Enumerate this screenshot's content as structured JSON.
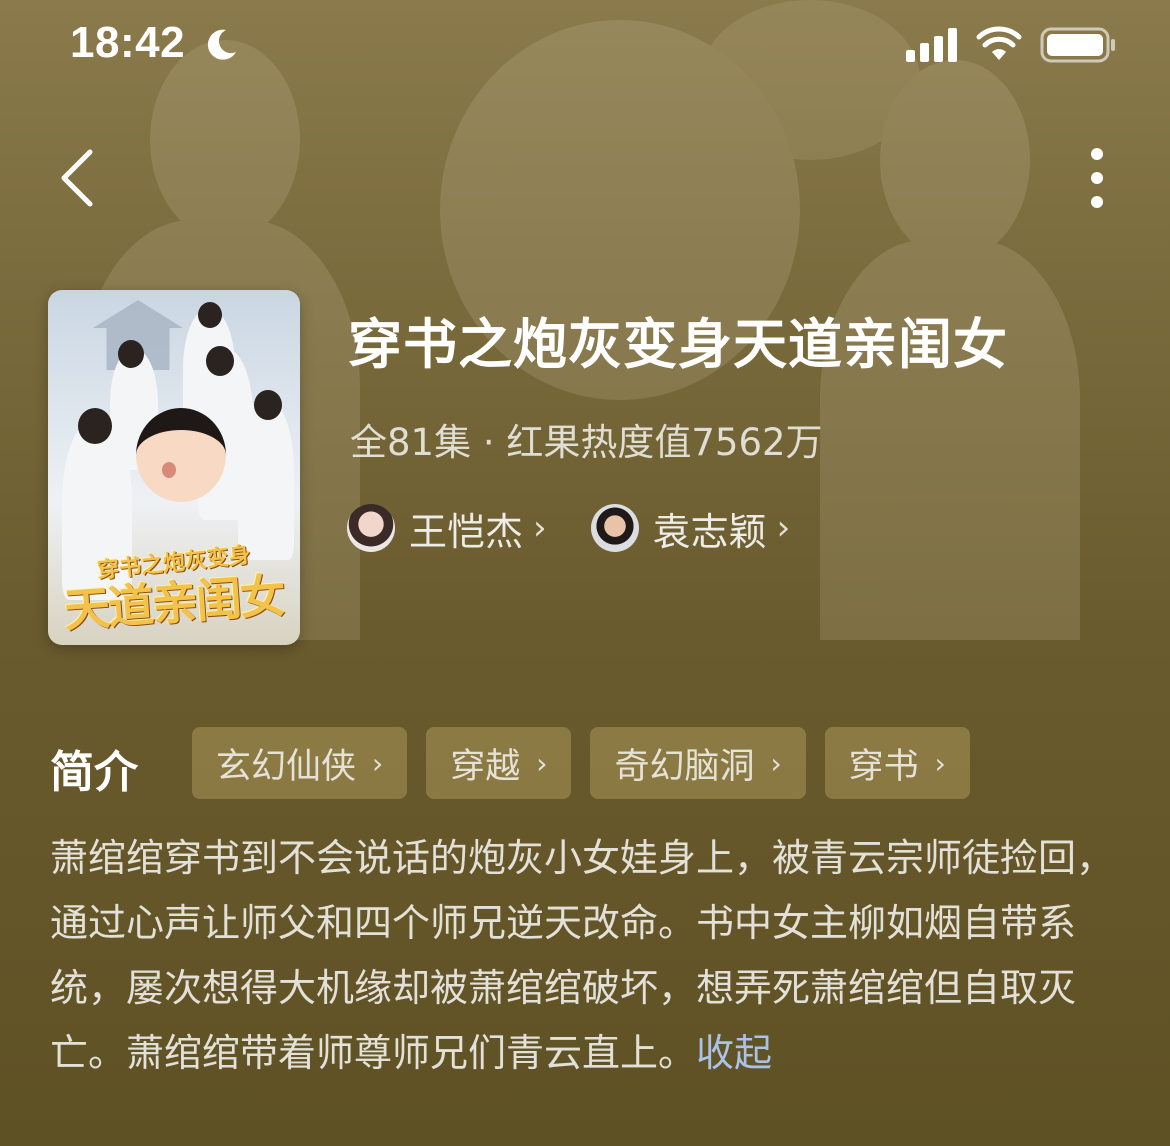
{
  "status_bar": {
    "time": "18:42"
  },
  "drama": {
    "title": "穿书之炮灰变身天道亲闺女",
    "meta": "全81集 · 红果热度值7562万",
    "cover_text": {
      "line1": "穿书之炮灰变身",
      "line2": "天道亲闺女"
    }
  },
  "actors": [
    {
      "name": "王恺杰"
    },
    {
      "name": "袁志颖"
    }
  ],
  "intro": {
    "label": "简介",
    "tags": [
      "玄幻仙侠",
      "穿越",
      "奇幻脑洞",
      "穿书"
    ],
    "text": "萧绾绾穿书到不会说话的炮灰小女娃身上，被青云宗师徒捡回，通过心声让师父和四个师兄逆天改命。书中女主柳如烟自带系统，屡次想得大机缘却被萧绾绾破坏，想弄死萧绾绾但自取灭亡。萧绾绾带着师尊师兄们青云直上。",
    "collapse": "收起"
  },
  "icons": {
    "back": "chevron-left-icon",
    "more": "more-vertical-icon",
    "chevron": "›"
  },
  "colors": {
    "link": "#a9c2e6",
    "background": "#6a5b2e"
  }
}
